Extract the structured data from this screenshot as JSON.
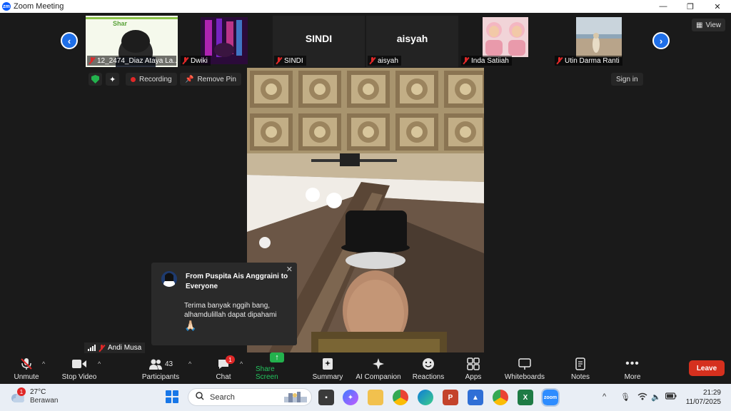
{
  "window": {
    "title": "Zoom Meeting",
    "app_icon": "zm"
  },
  "gallery": {
    "tiles": [
      {
        "name": "12_2474_Diaz Ataya La...",
        "kind": "video"
      },
      {
        "name": "Dwiki",
        "kind": "video"
      },
      {
        "name": "SINDI",
        "big_name": "SINDI",
        "kind": "name"
      },
      {
        "name": "aisyah",
        "big_name": "aisyah",
        "kind": "name"
      },
      {
        "name": "Inda Satiiah",
        "kind": "video"
      },
      {
        "name": "Utin Darma Ranti",
        "kind": "video"
      }
    ],
    "tile1_banner": "Shar"
  },
  "view_label": "View",
  "status": {
    "recording_label": "Recording",
    "remove_pin_label": "Remove Pin",
    "sign_in_label": "Sign in"
  },
  "pinned": {
    "name": "Andi Musa"
  },
  "chat_popup": {
    "from": "From Puspita Ais Anggraini to Everyone",
    "message": "Terima banyak nggih bang, alhamdulillah dapat dipahami",
    "emoji": "🙏🏻"
  },
  "toolbar": {
    "unmute": "Unmute",
    "stop_video": "Stop Video",
    "participants": "Participants",
    "participants_count": "43",
    "chat": "Chat",
    "chat_badge": "1",
    "share_screen": "Share Screen",
    "summary": "Summary",
    "ai_companion": "AI Companion",
    "reactions": "Reactions",
    "apps": "Apps",
    "whiteboards": "Whiteboards",
    "notes": "Notes",
    "more": "More",
    "leave": "Leave"
  },
  "taskbar": {
    "weather_temp": "27°C",
    "weather_cond": "Berawan",
    "weather_badge": "1",
    "search_placeholder": "Search",
    "time": "21:29",
    "date": "11/07/2025"
  },
  "colors": {
    "accent": "#1f6fe8",
    "share": "#23b14d",
    "leave": "#d5301e",
    "alert": "#e02828"
  }
}
